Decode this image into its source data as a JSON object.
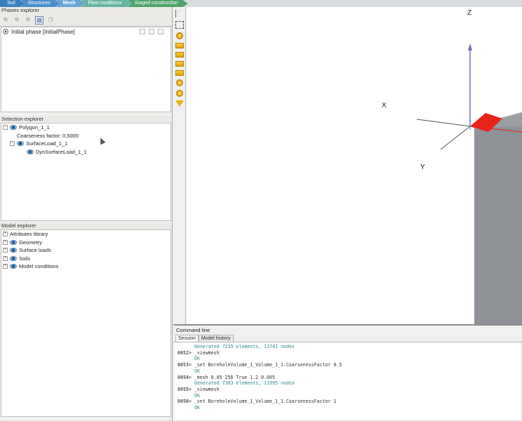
{
  "tabs": [
    {
      "label": "Soil",
      "key": "soil"
    },
    {
      "label": "Structures",
      "key": "structures"
    },
    {
      "label": "Mesh",
      "key": "mesh"
    },
    {
      "label": "Flow conditions",
      "key": "flow"
    },
    {
      "label": "Staged construction",
      "key": "staged"
    }
  ],
  "phases": {
    "title": "Phases explorer",
    "items": [
      {
        "label": "Initial phase [InitialPhase]"
      }
    ]
  },
  "selection": {
    "title": "Selection explorer",
    "polygon": "Polygon_1_1",
    "coarseness": "Coarseness factor: 0,5000",
    "surface_load": "SurfaceLoad_1_1",
    "dyn_load": "DynSurfaceLoad_1_1"
  },
  "model": {
    "title": "Model explorer",
    "items": [
      "Attributes library",
      "Geometry",
      "Surface loads",
      "Soils",
      "Model conditions"
    ]
  },
  "viewport": {
    "axis_x": "X",
    "axis_y": "Y",
    "axis_z": "Z"
  },
  "command": {
    "title": "Command line",
    "tabs": [
      "Session",
      "Model history"
    ],
    "lines": [
      {
        "type": "out",
        "text": "Generated 7235 elements, 11741 nodes"
      },
      {
        "type": "in",
        "num": "0052>",
        "text": " _viewmesh"
      },
      {
        "type": "out",
        "text": "OK"
      },
      {
        "type": "in",
        "num": "0053>",
        "text": " _set BoreholeVolume_1_Volume_1_1.CoarsenessFactor 0.5"
      },
      {
        "type": "out",
        "text": "OK"
      },
      {
        "type": "in",
        "num": "0054>",
        "text": " _mesh 0.05 256 True 1.2 0.005"
      },
      {
        "type": "out",
        "text": "Generated 7383 elements, 11995 nodes"
      },
      {
        "type": "in",
        "num": "0055>",
        "text": " _viewmesh"
      },
      {
        "type": "out",
        "text": "OK"
      },
      {
        "type": "in",
        "num": "0056>",
        "text": " _set BoreholeVolume_1_Volume_1_1.CoarsenessFactor 1"
      },
      {
        "type": "out",
        "text": "OK"
      }
    ]
  },
  "colors": {
    "accent": "#3b7fbf",
    "load_red": "#e8241a",
    "volume_grey": "#8f9296",
    "axis_z_blue": "#6a6fb8"
  }
}
